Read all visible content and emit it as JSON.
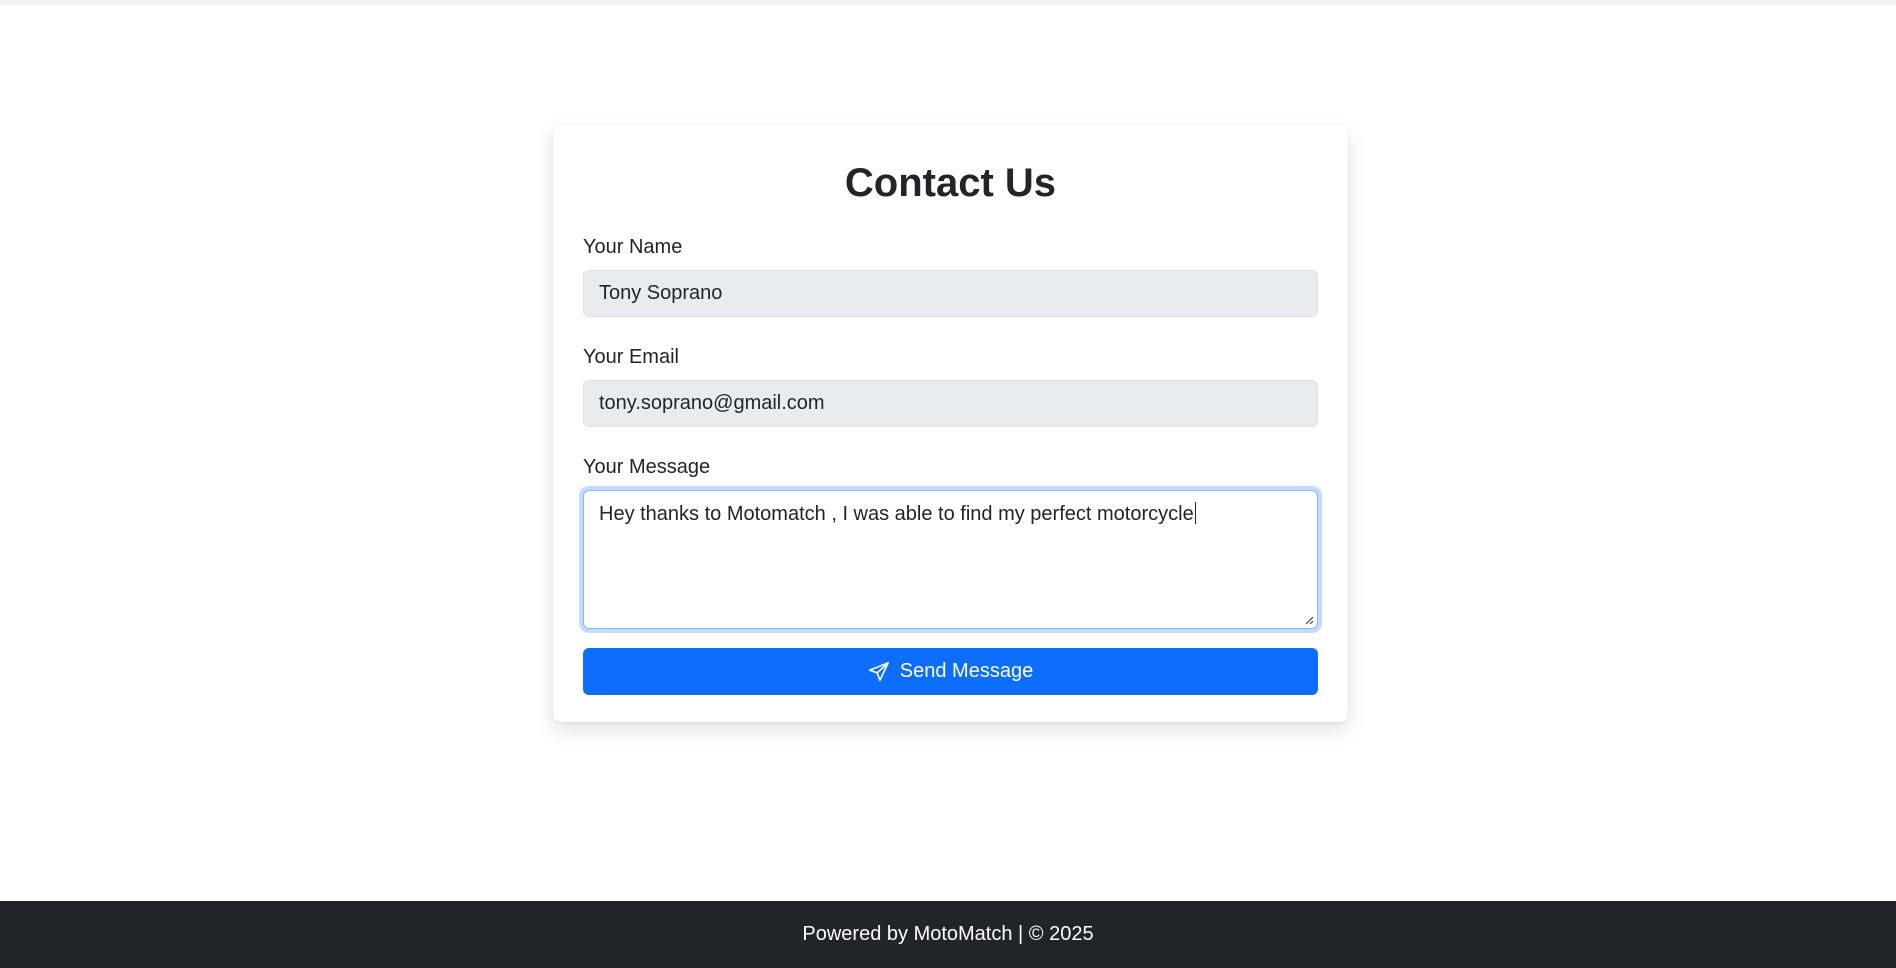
{
  "contact_form": {
    "title": "Contact Us",
    "name_label": "Your Name",
    "name_value": "Tony Soprano",
    "email_label": "Your Email",
    "email_value": "tony.soprano@gmail.com",
    "message_label": "Your Message",
    "message_value": "Hey thanks to Motomatch , I was able to find my perfect motorcycle",
    "send_label": "Send Message",
    "send_icon": "send-icon"
  },
  "footer": {
    "text": "Powered by MotoMatch | © 2025"
  },
  "colors": {
    "primary": "#0d6efd",
    "footer_bg": "#212529",
    "input_bg": "#e9ecef",
    "focus_border": "#86b7fe"
  }
}
